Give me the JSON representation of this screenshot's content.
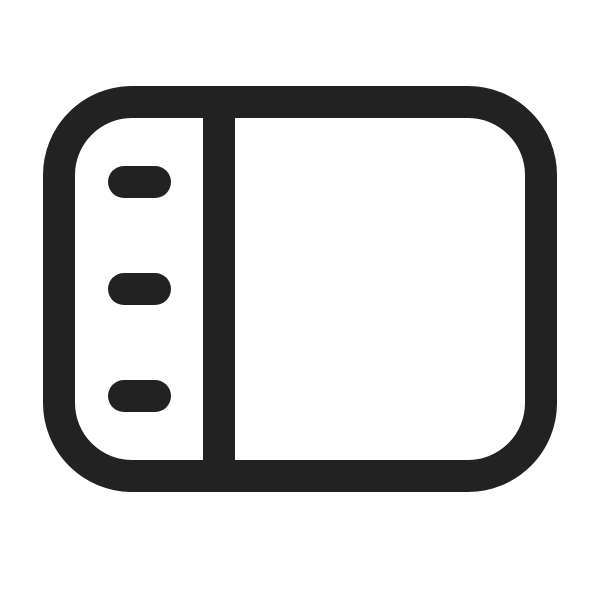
{
  "icon": {
    "name": "sidebar-layout-icon",
    "stroke_color": "#222222",
    "background_color": "#ffffff"
  }
}
